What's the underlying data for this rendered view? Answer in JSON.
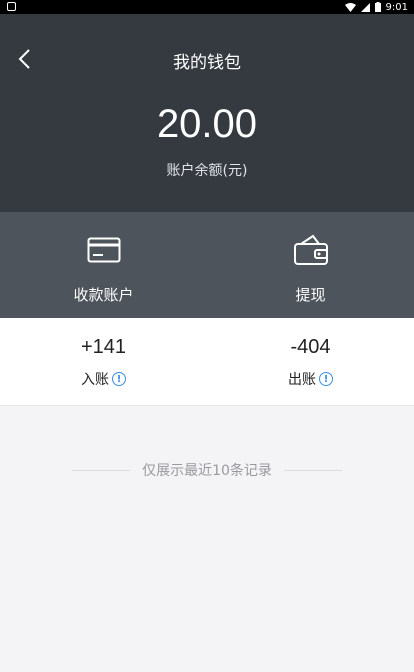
{
  "status_bar": {
    "time": "9:01"
  },
  "header": {
    "title": "我的钱包",
    "balance": "20.00",
    "balance_label": "账户余额(元)"
  },
  "actions": [
    {
      "label": "收款账户",
      "icon": "bank-card-icon"
    },
    {
      "label": "提现",
      "icon": "wallet-icon"
    }
  ],
  "stats": {
    "income": {
      "value": "+141",
      "label": "入账"
    },
    "expense": {
      "value": "-404",
      "label": "出账"
    }
  },
  "notice": "仅展示最近10条记录",
  "colors": {
    "header_bg": "#353a41",
    "actions_bg": "#4d545c",
    "info_accent": "#3d8fe0",
    "page_bg": "#f4f4f6"
  }
}
